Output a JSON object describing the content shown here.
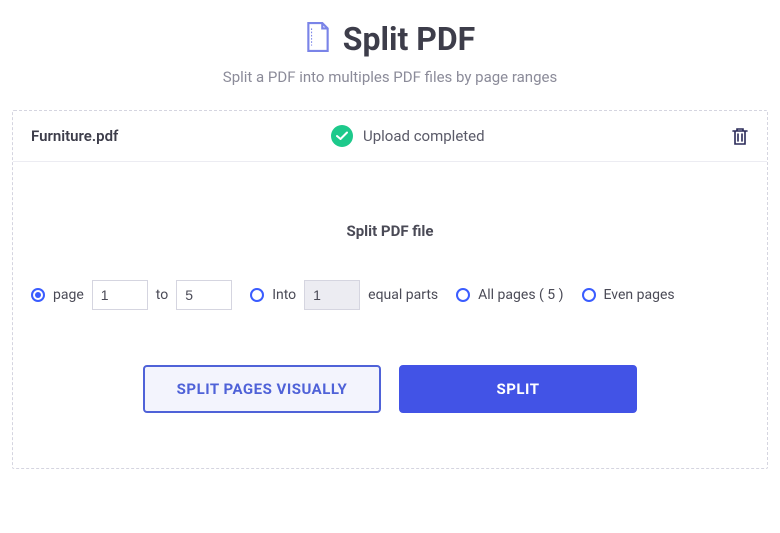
{
  "header": {
    "title": "Split PDF",
    "subtitle": "Split a PDF into multiples PDF files by page ranges"
  },
  "upload": {
    "filename": "Furniture.pdf",
    "status": "Upload completed"
  },
  "section_title": "Split PDF file",
  "options": {
    "page_label": "page",
    "page_from": "1",
    "page_to_label": "to",
    "page_to": "5",
    "into_label": "Into",
    "into_value": "1",
    "into_suffix": "equal parts",
    "all_pages_label": "All pages ( 5 )",
    "even_pages_label": "Even pages"
  },
  "buttons": {
    "visual": "SPLIT PAGES VISUALLY",
    "split": "SPLIT"
  }
}
